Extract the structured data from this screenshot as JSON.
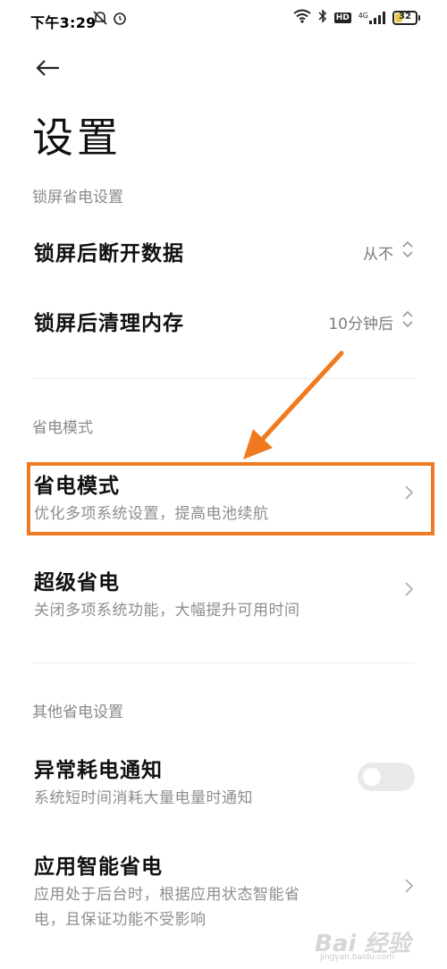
{
  "status_bar": {
    "time": "下午3:29",
    "battery": "32",
    "network": "4G",
    "hd": "HD"
  },
  "page": {
    "title": "设置"
  },
  "sections": {
    "lock_screen": {
      "label": "锁屏省电设置",
      "items": [
        {
          "title": "锁屏后断开数据",
          "value": "从不"
        },
        {
          "title": "锁屏后清理内存",
          "value": "10分钟后"
        }
      ]
    },
    "power_mode": {
      "label": "省电模式",
      "items": [
        {
          "title": "省电模式",
          "subtitle": "优化多项系统设置，提高电池续航"
        },
        {
          "title": "超级省电",
          "subtitle": "关闭多项系统功能，大幅提升可用时间"
        }
      ]
    },
    "other": {
      "label": "其他省电设置",
      "items": [
        {
          "title": "异常耗电通知",
          "subtitle": "系统短时间消耗大量电量时通知",
          "toggle": false
        },
        {
          "title": "应用智能省电",
          "subtitle_line1": "应用处于后台时，根据应用状态智能省",
          "subtitle_line2": "电，且保证功能不受影响"
        }
      ]
    }
  },
  "annotation": {
    "color": "#f07a1f"
  },
  "watermark": {
    "text": "Bai 经验",
    "sub": "jingyan.baidu.com"
  },
  "colors": {
    "accent_orange": "#f07a1f",
    "secondary_text": "#8e8e8e"
  }
}
